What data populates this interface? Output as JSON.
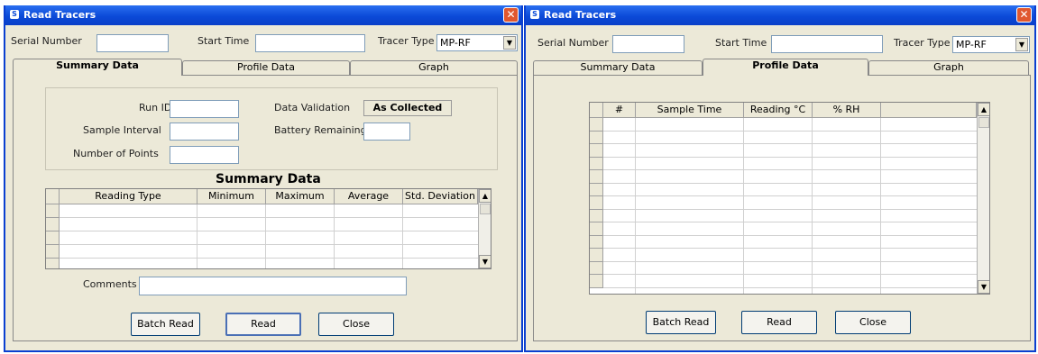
{
  "left": {
    "title": "Read Tracers",
    "serial_label": "Serial Number",
    "start_label": "Start Time",
    "tracer_label": "Tracer Type",
    "tracer_value": "MP-RF",
    "tabs": [
      "Summary Data",
      "Profile Data",
      "Graph"
    ],
    "run_id_label": "Run ID",
    "sample_interval_label": "Sample Interval",
    "num_points_label": "Number of Points",
    "data_validation_label": "Data Validation",
    "data_validation_value": "As Collected",
    "battery_label": "Battery Remaining:",
    "summary_heading": "Summary Data",
    "columns": [
      "Reading Type",
      "Minimum",
      "Maximum",
      "Average",
      "Std. Deviation"
    ],
    "comments_label": "Comments",
    "buttons": {
      "batch": "Batch Read",
      "read": "Read",
      "close": "Close"
    }
  },
  "right": {
    "title": "Read Tracers",
    "serial_label": "Serial Number",
    "start_label": "Start Time",
    "tracer_label": "Tracer Type",
    "tracer_value": "MP-RF",
    "tabs": [
      "Summary Data",
      "Profile Data",
      "Graph"
    ],
    "columns": [
      "#",
      "Sample Time",
      "Reading °C",
      "% RH"
    ],
    "buttons": {
      "batch": "Batch Read",
      "read": "Read",
      "close": "Close"
    }
  },
  "icons": {
    "app": "app-icon",
    "close": "close-icon",
    "dropdown": "chevron-down-icon",
    "scroll_up": "scroll-up-arrow-icon",
    "scroll_down": "scroll-down-arrow-icon"
  }
}
